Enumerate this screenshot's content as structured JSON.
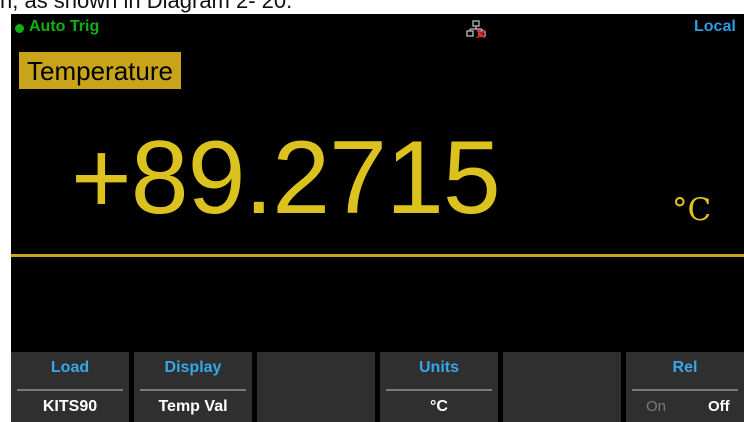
{
  "document_text": "n, as shown in Diagram 2- 20.",
  "status_bar": {
    "trigger_mode": "Auto Trig",
    "network_icon": "network-disconnected-icon",
    "remote_state": "Local"
  },
  "measurement": {
    "function": "Temperature",
    "value": "+89.2715",
    "unit": "°C"
  },
  "softkeys": [
    {
      "title": "Load",
      "value": "KITS90"
    },
    {
      "title": "Display",
      "value": "Temp Val"
    },
    {
      "title": "",
      "value": ""
    },
    {
      "title": "Units",
      "value": "°C"
    },
    {
      "title": "",
      "value": ""
    },
    {
      "title": "Rel",
      "on_label": "On",
      "off_label": "Off",
      "selected": "Off"
    }
  ],
  "colors": {
    "background": "#000000",
    "accent_yellow": "#dcc21e",
    "label_gold": "#c8a41a",
    "status_green": "#11b011",
    "softkey_blue": "#35a8ec",
    "softkey_bg": "#2f2f2f"
  }
}
